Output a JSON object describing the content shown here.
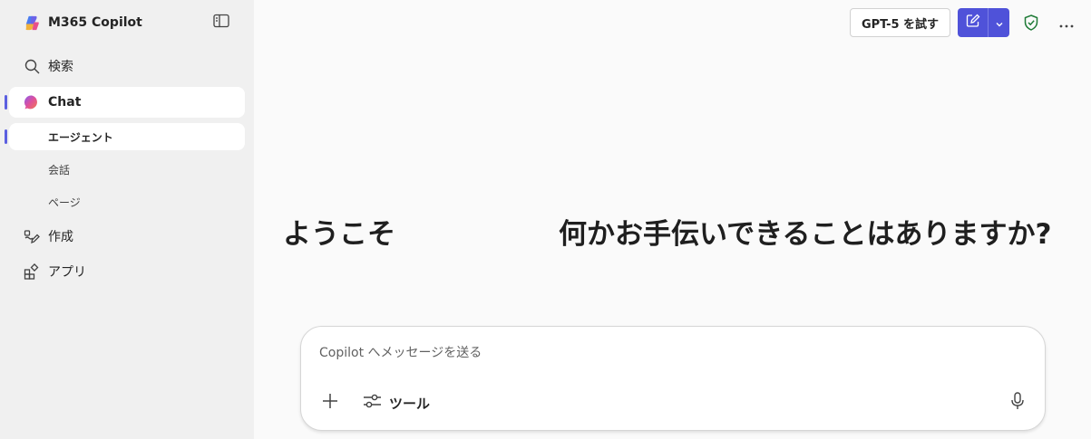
{
  "app": {
    "title": "M365 Copilot"
  },
  "sidebar": {
    "items": [
      {
        "label": "検索",
        "icon": "search-icon"
      },
      {
        "label": "Chat",
        "icon": "copilot-chat-icon"
      },
      {
        "label": "作成",
        "icon": "create-icon"
      },
      {
        "label": "アプリ",
        "icon": "apps-icon"
      }
    ],
    "chat_subitems": [
      {
        "label": "エージェント"
      },
      {
        "label": "会話"
      },
      {
        "label": "ページ"
      }
    ]
  },
  "toolbar": {
    "try_label": "GPT-5 を試す",
    "accent": "#4f52d9"
  },
  "greeting": {
    "prefix": "ようこそ",
    "question": "何かお手伝いできることはありますか?"
  },
  "composer": {
    "placeholder": "Copilot へメッセージを送る",
    "tools_label": "ツール"
  }
}
